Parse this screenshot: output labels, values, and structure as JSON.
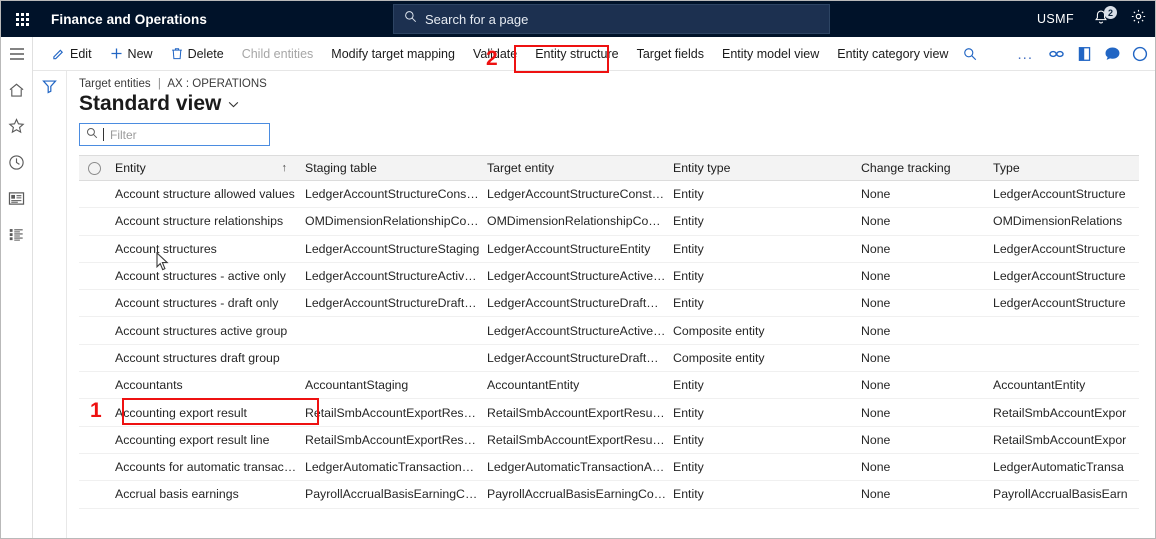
{
  "header": {
    "waffle_icon": "waffle-grid-icon",
    "app_title": "Finance and Operations",
    "search_placeholder": "Search for a page",
    "search_icon": "search-icon",
    "company": "USMF",
    "bell_icon": "notification-bell-icon",
    "notification_count": "2",
    "settings_icon": "gear-icon"
  },
  "nav_rail": {
    "items": [
      {
        "name": "hamburger-menu-icon",
        "label": "Expand navigation"
      },
      {
        "name": "home-icon",
        "label": "Home"
      },
      {
        "name": "star-icon",
        "label": "Favorites"
      },
      {
        "name": "clock-icon",
        "label": "Recent"
      },
      {
        "name": "workspaces-icon",
        "label": "Workspaces"
      },
      {
        "name": "modules-list-icon",
        "label": "Modules"
      }
    ]
  },
  "action_pane": {
    "buttons": [
      {
        "label": "Edit",
        "icon": "pencil-icon",
        "disabled": false
      },
      {
        "label": "New",
        "icon": "plus-icon",
        "disabled": false
      },
      {
        "label": "Delete",
        "icon": "trash-icon",
        "disabled": false
      },
      {
        "label": "Child entities",
        "icon": "",
        "disabled": true
      },
      {
        "label": "Modify target mapping",
        "icon": "",
        "disabled": false
      },
      {
        "label": "Validate",
        "icon": "",
        "disabled": false
      },
      {
        "label": "Entity structure",
        "icon": "",
        "disabled": false
      },
      {
        "label": "Target fields",
        "icon": "",
        "disabled": false
      },
      {
        "label": "Entity model view",
        "icon": "",
        "disabled": false
      },
      {
        "label": "Entity category view",
        "icon": "",
        "disabled": false
      }
    ],
    "search_icon": "search-icon",
    "overflow_label": "...",
    "right_icons": [
      {
        "name": "attach-link-icon"
      },
      {
        "name": "open-in-office-icon"
      },
      {
        "name": "comments-icon",
        "badge": "0"
      },
      {
        "name": "help-icon"
      }
    ]
  },
  "page": {
    "filter_rail_icon": "funnel-filter-icon",
    "breadcrumb_parent": "Target entities",
    "breadcrumb_separator": "|",
    "breadcrumb_current": "AX : OPERATIONS",
    "title": "Standard view",
    "title_chevron": "chevron-down-icon",
    "filter_placeholder": "Filter",
    "filter_value": "",
    "filter_icon": "search-icon"
  },
  "grid": {
    "sort_indicator": "↑",
    "sorted_column": "Entity",
    "columns": [
      "Entity",
      "Staging table",
      "Target entity",
      "Entity type",
      "Change tracking",
      "Type"
    ],
    "rows": [
      {
        "entity": "Account structure allowed values",
        "staging": "LedgerAccountStructureConstra...",
        "target": "LedgerAccountStructureConstra...",
        "entity_type": "Entity",
        "change_tracking": "None",
        "type": "LedgerAccountStructure"
      },
      {
        "entity": "Account structure relationships",
        "staging": "OMDimensionRelationshipCons...",
        "target": "OMDimensionRelationshipCons...",
        "entity_type": "Entity",
        "change_tracking": "None",
        "type": "OMDimensionRelations"
      },
      {
        "entity": "Account structures",
        "staging": "LedgerAccountStructureStaging",
        "target": "LedgerAccountStructureEntity",
        "entity_type": "Entity",
        "change_tracking": "None",
        "type": "LedgerAccountStructure"
      },
      {
        "entity": "Account structures - active only",
        "staging": "LedgerAccountStructureActiveO...",
        "target": "LedgerAccountStructureActiveO...",
        "entity_type": "Entity",
        "change_tracking": "None",
        "type": "LedgerAccountStructure"
      },
      {
        "entity": "Account structures - draft only",
        "staging": "LedgerAccountStructureDraftOn...",
        "target": "LedgerAccountStructureDraftOn...",
        "entity_type": "Entity",
        "change_tracking": "None",
        "type": "LedgerAccountStructure"
      },
      {
        "entity": "Account structures active group",
        "staging": "",
        "target": "LedgerAccountStructureActiveO...",
        "entity_type": "Composite entity",
        "change_tracking": "None",
        "type": ""
      },
      {
        "entity": "Account structures draft group",
        "staging": "",
        "target": "LedgerAccountStructureDraftOn...",
        "entity_type": "Composite entity",
        "change_tracking": "None",
        "type": ""
      },
      {
        "entity": "Accountants",
        "staging": "AccountantStaging",
        "target": "AccountantEntity",
        "entity_type": "Entity",
        "change_tracking": "None",
        "type": "AccountantEntity"
      },
      {
        "entity": "Accounting export result",
        "staging": "RetailSmbAccountExportResultS...",
        "target": "RetailSmbAccountExportResultE...",
        "entity_type": "Entity",
        "change_tracking": "None",
        "type": "RetailSmbAccountExpor"
      },
      {
        "entity": "Accounting export result line",
        "staging": "RetailSmbAccountExportResultL...",
        "target": "RetailSmbAccountExportResultL...",
        "entity_type": "Entity",
        "change_tracking": "None",
        "type": "RetailSmbAccountExpor"
      },
      {
        "entity": "Accounts for automatic transacti...",
        "staging": "LedgerAutomaticTransactionAcc...",
        "target": "LedgerAutomaticTransactionAcc...",
        "entity_type": "Entity",
        "change_tracking": "None",
        "type": "LedgerAutomaticTransa"
      },
      {
        "entity": "Accrual basis earnings",
        "staging": "PayrollAccrualBasisEarningCode...",
        "target": "PayrollAccrualBasisEarningCode...",
        "entity_type": "Entity",
        "change_tracking": "None",
        "type": "PayrollAccrualBasisEarn"
      }
    ]
  },
  "annotations": {
    "color": "#ee1111",
    "markers": [
      {
        "number": "1",
        "targets": "Accountants"
      },
      {
        "number": "2",
        "targets": "Entity structure"
      }
    ]
  }
}
